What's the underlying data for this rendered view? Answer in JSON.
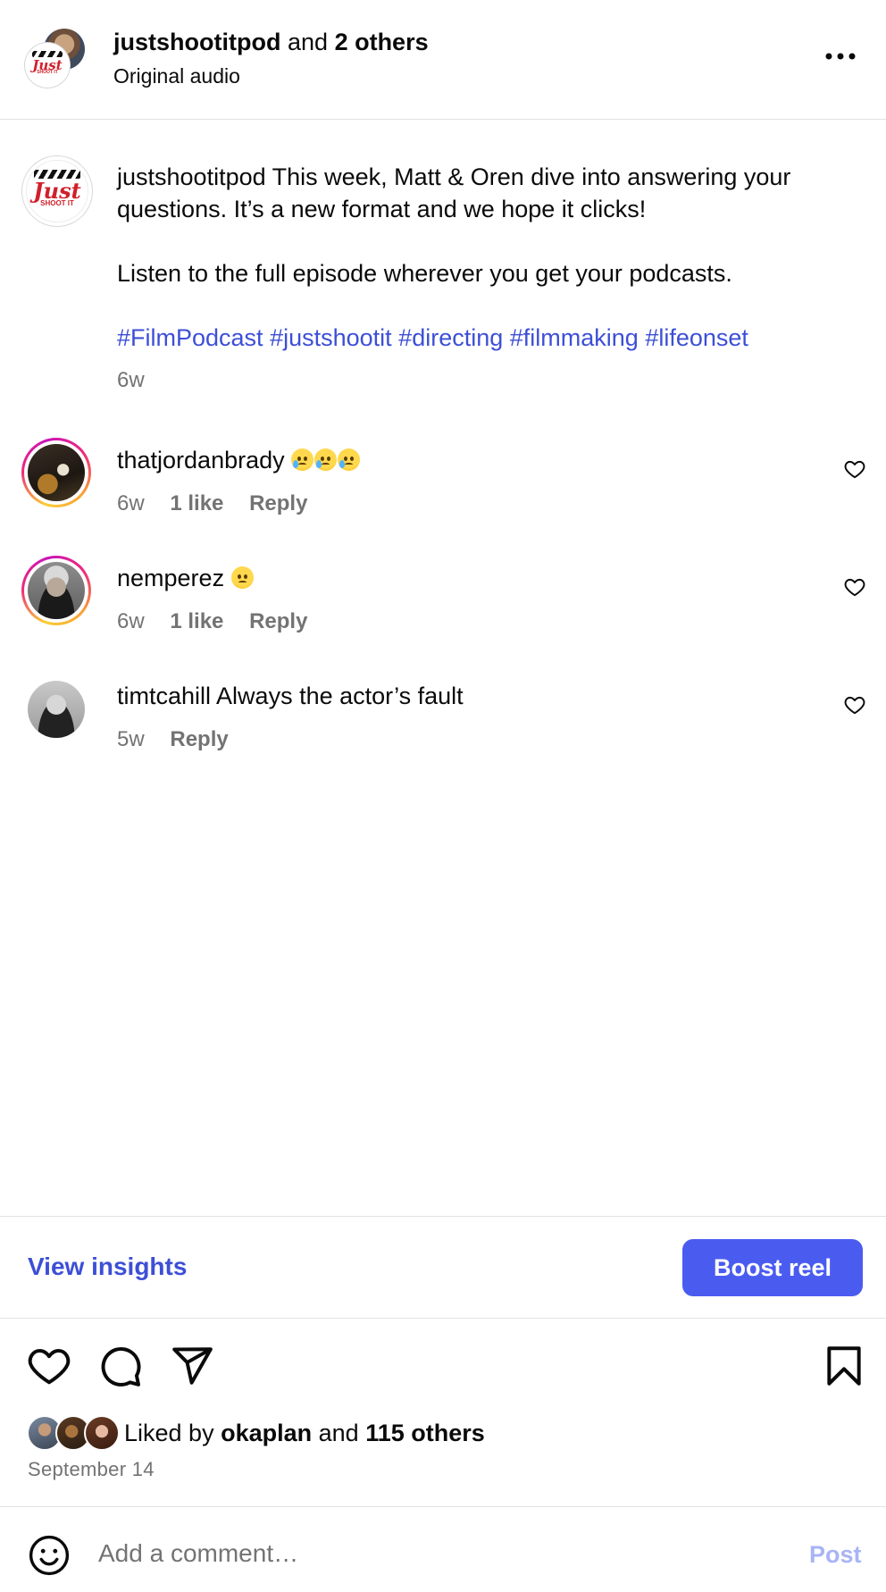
{
  "header": {
    "username": "justshootitpod",
    "and_text": "and",
    "others": "2 others",
    "audio": "Original audio",
    "more_icon": "more-horizontal-icon"
  },
  "logo": {
    "word": "Just",
    "small": "SHOOT IT"
  },
  "caption": {
    "username": "justshootitpod",
    "text": "This week, Matt & Oren dive into answering your questions. It’s a new format and we hope it clicks!",
    "paragraph2": "Listen to the full episode wherever you get your podcasts.",
    "hashtags": [
      "#FilmPodcast",
      "#justshootit",
      "#directing",
      "#filmmaking",
      "#lifeonset"
    ],
    "time": "6w"
  },
  "comments": [
    {
      "username": "thatjordanbrady",
      "text": "",
      "emoji": "crying-face x3",
      "time": "6w",
      "likes": "1 like",
      "reply": "Reply"
    },
    {
      "username": "nemperez",
      "text": "",
      "emoji": "pleading-face",
      "time": "6w",
      "likes": "1 like",
      "reply": "Reply"
    },
    {
      "username": "timtcahill",
      "text": "Always the actor’s fault",
      "time": "5w",
      "reply": "Reply"
    }
  ],
  "insights": {
    "view": "View insights",
    "boost": "Boost reel",
    "boost_color": "#4a5cf0",
    "link_color": "#3d4fd6"
  },
  "actions": {
    "like_icon": "heart-icon",
    "comment_icon": "comment-icon",
    "share_icon": "send-icon",
    "save_icon": "bookmark-icon"
  },
  "likes": {
    "prefix": "Liked by",
    "user": "okaplan",
    "and": "and",
    "others": "115 others"
  },
  "date": "September 14",
  "composer": {
    "placeholder": "Add a comment…",
    "post": "Post",
    "emoji_icon": "smiley-icon"
  }
}
